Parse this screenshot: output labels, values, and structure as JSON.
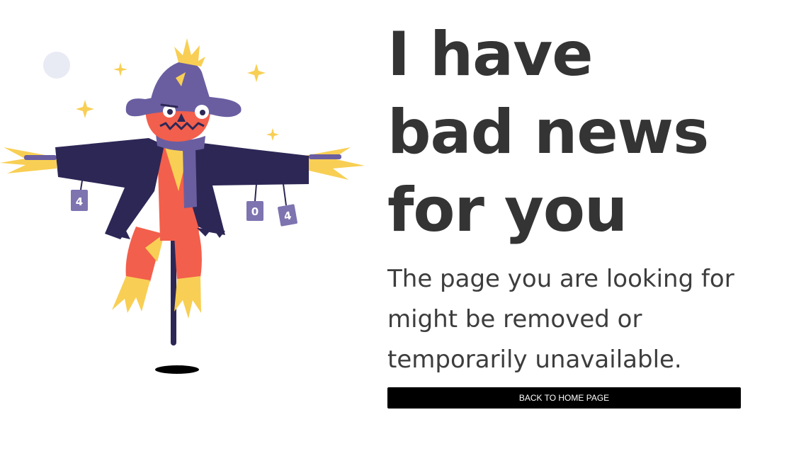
{
  "headline": "I have bad news for you",
  "message": "The page you are looking for might be removed or temporarily unavailable.",
  "button_label": "BACK TO HOME PAGE",
  "illustration": {
    "can_labels": [
      "4",
      "0",
      "4"
    ]
  },
  "colors": {
    "button_bg": "#000000",
    "text": "#343434",
    "hat": "#6a5ea1",
    "coat": "#2d2756",
    "face": "#f25f4c",
    "straw": "#f8cf54"
  }
}
